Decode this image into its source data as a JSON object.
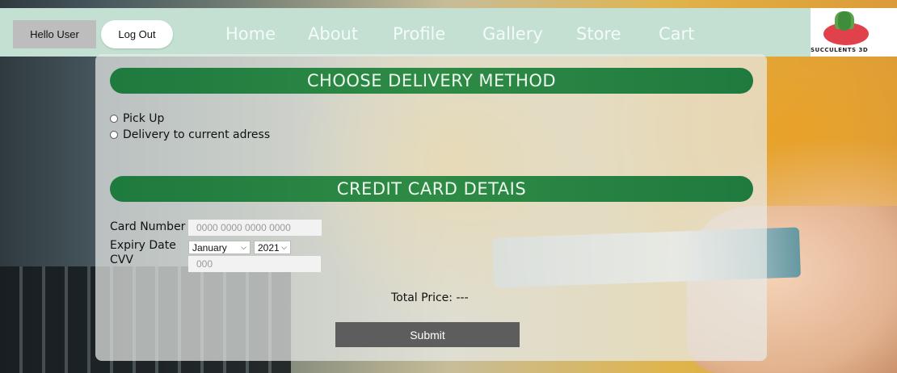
{
  "header": {
    "greeting": "Hello User",
    "logout_label": "Log Out",
    "nav": [
      "Home",
      "About",
      "Profile",
      "Gallery",
      "Store",
      "Cart"
    ],
    "logo_text": "SUCCULENTS 3D",
    "bar_color": "#c3e0d3"
  },
  "delivery": {
    "title": "CHOOSE DELIVERY METHOD",
    "options": [
      "Pick Up",
      "Delivery to current adress"
    ]
  },
  "card": {
    "title": "CREDIT CARD DETAIS",
    "number_label": "Card Number",
    "number_placeholder": "0000 0000 0000 0000",
    "expiry_label": "Expiry Date",
    "month_value": "January",
    "year_value": "2021",
    "cvv_label": "CVV",
    "cvv_placeholder": "000"
  },
  "summary": {
    "total_text": "Total Price: ---",
    "submit_label": "Submit"
  },
  "colors": {
    "section_green": "#2e8b45",
    "submit_gray": "#5d5d5d"
  }
}
